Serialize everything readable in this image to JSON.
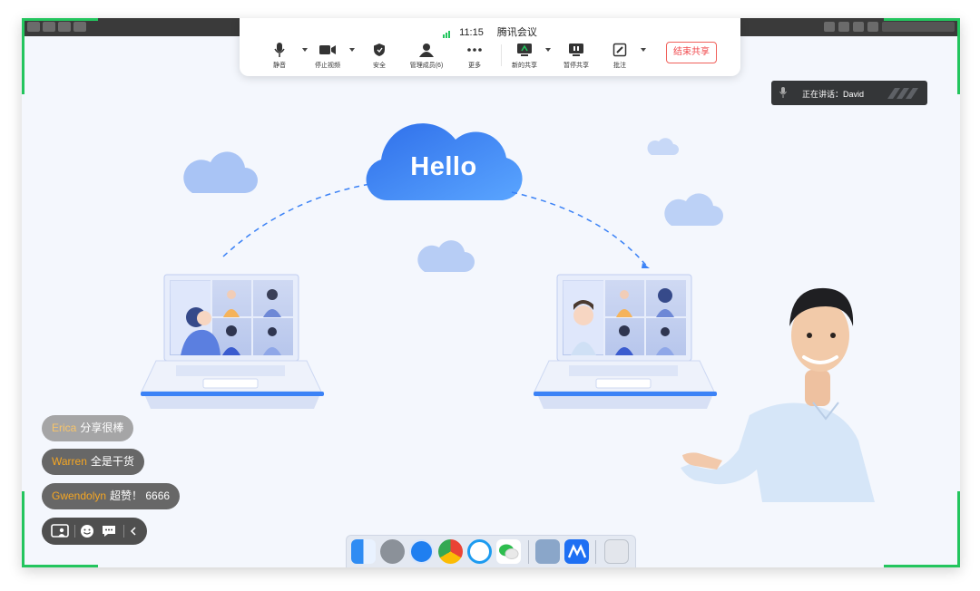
{
  "toolbar": {
    "time": "11:15",
    "app_title": "腾讯会议",
    "items": {
      "mute": "静音",
      "stop_video": "停止视频",
      "security": "安全",
      "manage_members": "管理成员(6)",
      "more": "更多",
      "new_share": "新的共享",
      "pause_share": "暂停共享",
      "annotate": "批注"
    },
    "end_share": "结束共享"
  },
  "speaking": {
    "label": "正在讲话：David"
  },
  "slide": {
    "cloud_text": "Hello"
  },
  "comments": [
    {
      "name": "Erica",
      "text": "分享很棒"
    },
    {
      "name": "Warren",
      "text": "全是干货"
    },
    {
      "name": "Gwendolyn",
      "text": "超赞！ 6666"
    }
  ],
  "dock": {
    "apps": [
      "finder-icon",
      "launchpad-icon",
      "safari-icon",
      "chrome-icon",
      "qq-browser-icon",
      "wechat-icon",
      "preview-icon",
      "tencent-meeting-icon",
      "trash-icon"
    ]
  },
  "colors": {
    "accent": "#3b82f6",
    "corner_green": "#23c55e",
    "end_red": "#f0464a",
    "name_orange": "#f5a623"
  }
}
